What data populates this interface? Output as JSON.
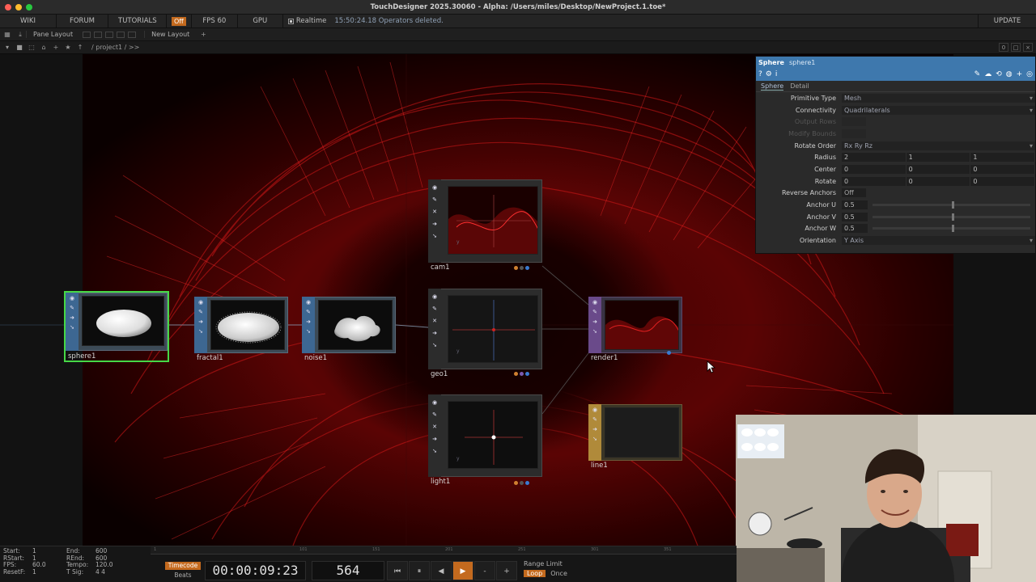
{
  "window": {
    "title": "TouchDesigner 2025.30060 - Alpha: /Users/miles/Desktop/NewProject.1.toe*"
  },
  "menubar": {
    "wiki": "WIKI",
    "forum": "FORUM",
    "tutorials": "TUTORIALS",
    "off_badge": "Off",
    "fps": "FPS  60",
    "gpu": "GPU",
    "realtime": "Realtime",
    "status": "15:50:24.18 Operators deleted.",
    "update": "UPDATE"
  },
  "toolbar": {
    "pane_layout": "Pane Layout",
    "new_layout": "New Layout",
    "plus": "+"
  },
  "pathbar": {
    "path": "/ project1 / >>",
    "right_count": "0"
  },
  "nodes": {
    "sphere": {
      "label": "sphere1",
      "color": "#3d6792"
    },
    "fractal": {
      "label": "fractal1",
      "color": "#3d6792"
    },
    "noise": {
      "label": "noise1",
      "color": "#3d6792"
    },
    "cam": {
      "label": "cam1",
      "color": "#3a3a3a"
    },
    "geo": {
      "label": "geo1",
      "color": "#3a3a3a"
    },
    "light": {
      "label": "light1",
      "color": "#3a3a3a"
    },
    "render": {
      "label": "render1",
      "color": "#6a4a8a"
    },
    "line": {
      "label": "line1",
      "color": "#b08a3a"
    }
  },
  "params": {
    "type": "Sphere",
    "name": "sphere1",
    "tabs": [
      "Sphere",
      "Detail"
    ],
    "rows": {
      "primitive_type": {
        "label": "Primitive Type",
        "value": "Mesh"
      },
      "connectivity": {
        "label": "Connectivity",
        "value": "Quadrilaterals"
      },
      "output_rows": {
        "label": "Output Rows",
        "value": ""
      },
      "modify_bounds": {
        "label": "Modify Bounds",
        "value": ""
      },
      "rotate_order": {
        "label": "Rotate Order",
        "value": "Rx Ry Rz"
      },
      "radius": {
        "label": "Radius",
        "x": "2",
        "y": "1",
        "z": "1"
      },
      "center": {
        "label": "Center",
        "x": "0",
        "y": "0",
        "z": "0"
      },
      "rotate": {
        "label": "Rotate",
        "x": "0",
        "y": "0",
        "z": "0"
      },
      "reverse_anchors": {
        "label": "Reverse Anchors",
        "value": "Off"
      },
      "anchor_u": {
        "label": "Anchor U",
        "value": "0.5"
      },
      "anchor_v": {
        "label": "Anchor V",
        "value": "0.5"
      },
      "anchor_w": {
        "label": "Anchor W",
        "value": "0.5"
      },
      "orientation": {
        "label": "Orientation",
        "value": "Y Axis"
      }
    },
    "header_color": "#3e78ad"
  },
  "timeline": {
    "stats": [
      {
        "k": "Start:",
        "v": "1",
        "k2": "End:",
        "v2": "600"
      },
      {
        "k": "RStart:",
        "v": "1",
        "k2": "REnd:",
        "v2": "600"
      },
      {
        "k": "FPS:",
        "v": "60.0",
        "k2": "Tempo:",
        "v2": "120.0"
      },
      {
        "k": "ResetF:",
        "v": "1",
        "k2": "T Sig:",
        "v2": "4    4"
      }
    ],
    "ruler": [
      "1",
      "101",
      "151",
      "201",
      "251",
      "301",
      "351"
    ],
    "mode_timecode": "Timecode",
    "mode_beats": "Beats",
    "timecode": "00:00:09:23",
    "frame": "564",
    "btn_start": "⏮",
    "btn_pause": "⏸",
    "btn_back": "◀",
    "btn_play": "▶",
    "btn_minus": "-",
    "btn_plus": "+",
    "range_limit": "Range Limit",
    "loop": "Loop",
    "once": "Once",
    "accent": "#c46a1e"
  }
}
